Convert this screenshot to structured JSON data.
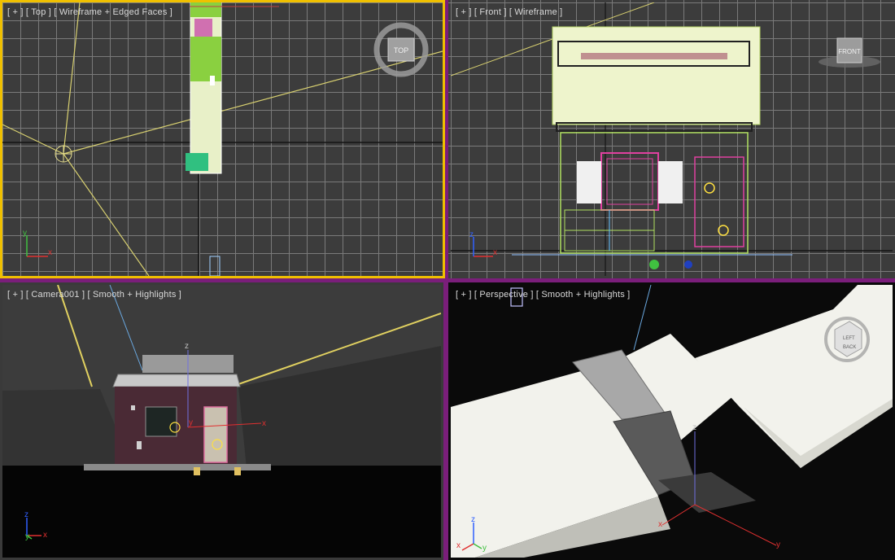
{
  "viewports": {
    "top": {
      "label": "[ + ] [ Top ] [ Wireframe + Edged Faces ]",
      "nav_text": "TOP",
      "axis_x": "x",
      "axis_y": "y"
    },
    "front": {
      "label": "[ + ] [ Front ] [ Wireframe ]",
      "nav_text": "FRONT",
      "axis_x": "x",
      "axis_y": "z"
    },
    "camera": {
      "label": "[ + ] [ Camera001 ] [ Smooth + Highlights ]",
      "gizmo_x": "x",
      "gizmo_y": "y",
      "gizmo_z": "z",
      "axis_x": "x",
      "axis_y": "y",
      "axis_z": "z"
    },
    "perspective": {
      "label": "[ + ] [ Perspective ] [ Smooth + Highlights ]",
      "gizmo_x": "x",
      "gizmo_y": "y",
      "gizmo_z": "z",
      "axis_x": "x",
      "axis_y": "y",
      "axis_z": "z",
      "cube_left": "LEFT",
      "cube_back": "BACK"
    }
  },
  "colors": {
    "active_border": "#f0c000",
    "frame_purple": "#7a1e7a",
    "grid_line": "#7a7a7a",
    "wire_bg": "#3c3c3c",
    "selection_yellow": "#e8e860",
    "wire_green": "#b0e060",
    "wire_magenta": "#e040a0"
  }
}
